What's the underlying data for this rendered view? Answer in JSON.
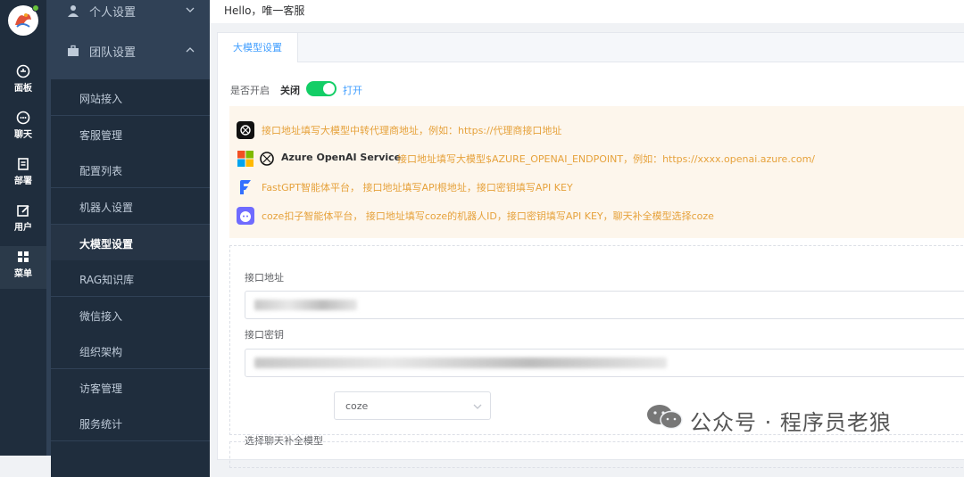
{
  "rail": [
    {
      "label": "面板",
      "icon": "dashboard-icon"
    },
    {
      "label": "聊天",
      "icon": "chat-icon"
    },
    {
      "label": "部署",
      "icon": "deploy-icon"
    },
    {
      "label": "用户",
      "icon": "user-edit-icon"
    },
    {
      "label": "菜单",
      "icon": "grid-icon",
      "active": true
    }
  ],
  "sidebar": {
    "personal": "个人设置",
    "team": "团队设置",
    "items": [
      "网站接入",
      "客服管理",
      "配置列表",
      "机器人设置",
      "大模型设置",
      "RAG知识库",
      "微信接入",
      "组织架构",
      "访客管理",
      "服务统计"
    ],
    "active_index": 4
  },
  "topbar": {
    "greeting": "Hello，唯一客服"
  },
  "tab": {
    "label": "大模型设置"
  },
  "switch": {
    "label": "是否开启",
    "off_label": "关闭",
    "on_label": "打开",
    "value": true
  },
  "notices": [
    {
      "icon": "openai-icon",
      "text": "接口地址填写大模型中转代理商地址，例如：https://代理商接口地址"
    },
    {
      "icon": "azure-openai-icon",
      "brand": "Azure OpenAI Service",
      "text": "接口地址填写大模型$AZURE_OPENAI_ENDPOINT，例如：https://xxxx.openai.azure.com/"
    },
    {
      "icon": "fastgpt-icon",
      "text": "FastGPT智能体平台， 接口地址填写API根地址，接口密钥填写API KEY"
    },
    {
      "icon": "coze-icon",
      "text": "coze扣子智能体平台， 接口地址填写coze的机器人ID，接口密钥填写API KEY，聊天补全模型选择coze"
    }
  ],
  "form": {
    "url_label": "接口地址",
    "key_label": "接口密钥",
    "model_label": "选择聊天补全模型",
    "model_value": "coze"
  },
  "watermark": {
    "text": "公众号 · 程序员老狼"
  },
  "colors": {
    "rail": "#1f2d3d",
    "sidebar": "#304156",
    "accent": "#409eff",
    "switch_on": "#13ce66",
    "notice_bg": "#fdf6ec",
    "notice_text": "#e6a23c"
  }
}
